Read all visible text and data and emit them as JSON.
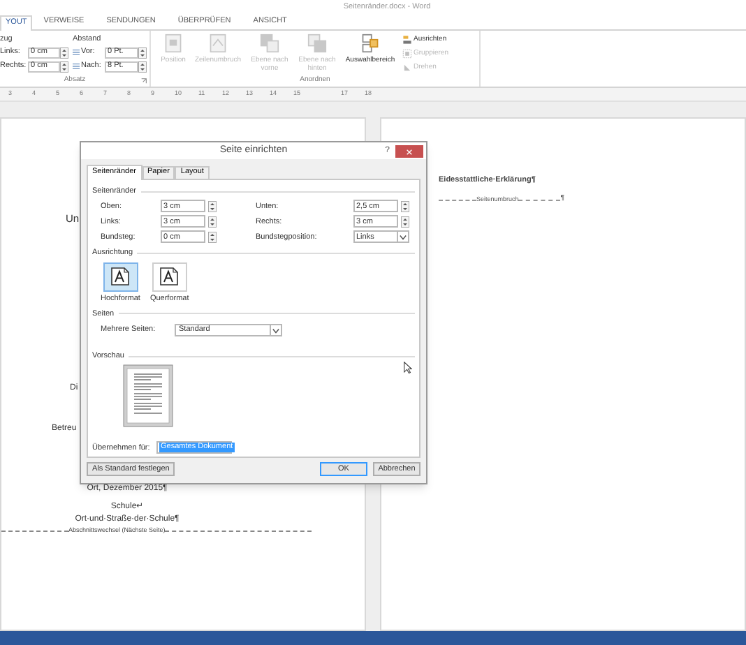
{
  "window": {
    "title": "Seitenränder.docx - Word"
  },
  "ribbon_tabs": [
    {
      "label": "YOUT",
      "selected": true
    },
    {
      "label": "VERWEISE",
      "selected": false
    },
    {
      "label": "SENDUNGEN",
      "selected": false
    },
    {
      "label": "ÜBERPRÜFEN",
      "selected": false
    },
    {
      "label": "ANSICHT",
      "selected": false
    }
  ],
  "absatz": {
    "einzug_label": "zug",
    "einzug": [
      {
        "label": "Links:",
        "value": "0 cm"
      },
      {
        "label": "Rechts:",
        "value": "0 cm"
      }
    ],
    "abstand_label": "Abstand",
    "abstand": [
      {
        "label": "Vor:",
        "value": "0 Pt."
      },
      {
        "label": "Nach:",
        "value": "8 Pt."
      }
    ],
    "group_label": "Absatz"
  },
  "anordnen": {
    "buttons": [
      {
        "label": "Position",
        "disabled": true
      },
      {
        "label": "Zeilenumbruch",
        "disabled": true
      },
      {
        "label": "Ebene nach vorne",
        "disabled": true
      },
      {
        "label": "Ebene nach hinten",
        "disabled": true
      },
      {
        "label": "Auswahlbereich",
        "disabled": false
      }
    ],
    "small_buttons": [
      {
        "label": "Ausrichten",
        "disabled": false
      },
      {
        "label": "Gruppieren",
        "disabled": true
      },
      {
        "label": "Drehen",
        "disabled": true
      }
    ],
    "group_label": "Anordnen"
  },
  "ruler": [
    "3",
    "4",
    "5",
    "6",
    "7",
    "8",
    "9",
    "10",
    "11",
    "12",
    "13",
    "14",
    "15",
    "17",
    "18"
  ],
  "left_page": {
    "fragments": [
      "Un",
      "Di",
      "Betreu"
    ],
    "lines": [
      "Ort, Dezember 2015¶",
      "Schule↵",
      "Ort·und·Straße·der·Schule¶"
    ],
    "section_break": "Abschnittswechsel (Nächste Seite)"
  },
  "right_page": {
    "heading": "Eidesstattliche·Erklärung¶",
    "page_break": "Seitenumbruch",
    "page_break_mark": "¶"
  },
  "dialog": {
    "title": "Seite einrichten",
    "help": "?",
    "tabs": [
      {
        "label": "Seitenränder",
        "selected": true
      },
      {
        "label": "Papier",
        "selected": false
      },
      {
        "label": "Layout",
        "selected": false
      }
    ],
    "margins_label": "Seitenränder",
    "margin_rows": [
      [
        {
          "label": "Oben:",
          "value": "3 cm",
          "kind": "spinner"
        },
        {
          "label": "Unten:",
          "value": "2,5 cm",
          "kind": "spinner"
        }
      ],
      [
        {
          "label": "Links:",
          "value": "3 cm",
          "kind": "spinner"
        },
        {
          "label": "Rechts:",
          "value": "3 cm",
          "kind": "spinner"
        }
      ],
      [
        {
          "label": "Bundsteg:",
          "value": "0 cm",
          "kind": "spinner"
        },
        {
          "label": "Bundstegposition:",
          "value": "Links",
          "kind": "dropdown"
        }
      ]
    ],
    "orientation_label": "Ausrichtung",
    "orientations": [
      {
        "label": "Hochformat",
        "selected": true
      },
      {
        "label": "Querformat",
        "selected": false
      }
    ],
    "pages_label": "Seiten",
    "multiple_pages": {
      "label": "Mehrere Seiten:",
      "value": "Standard"
    },
    "preview_label": "Vorschau",
    "apply_to": {
      "label": "Übernehmen für:",
      "value": "Gesamtes Dokument"
    },
    "buttons": {
      "default": "Als Standard festlegen",
      "ok": "OK",
      "cancel": "Abbrechen"
    }
  }
}
